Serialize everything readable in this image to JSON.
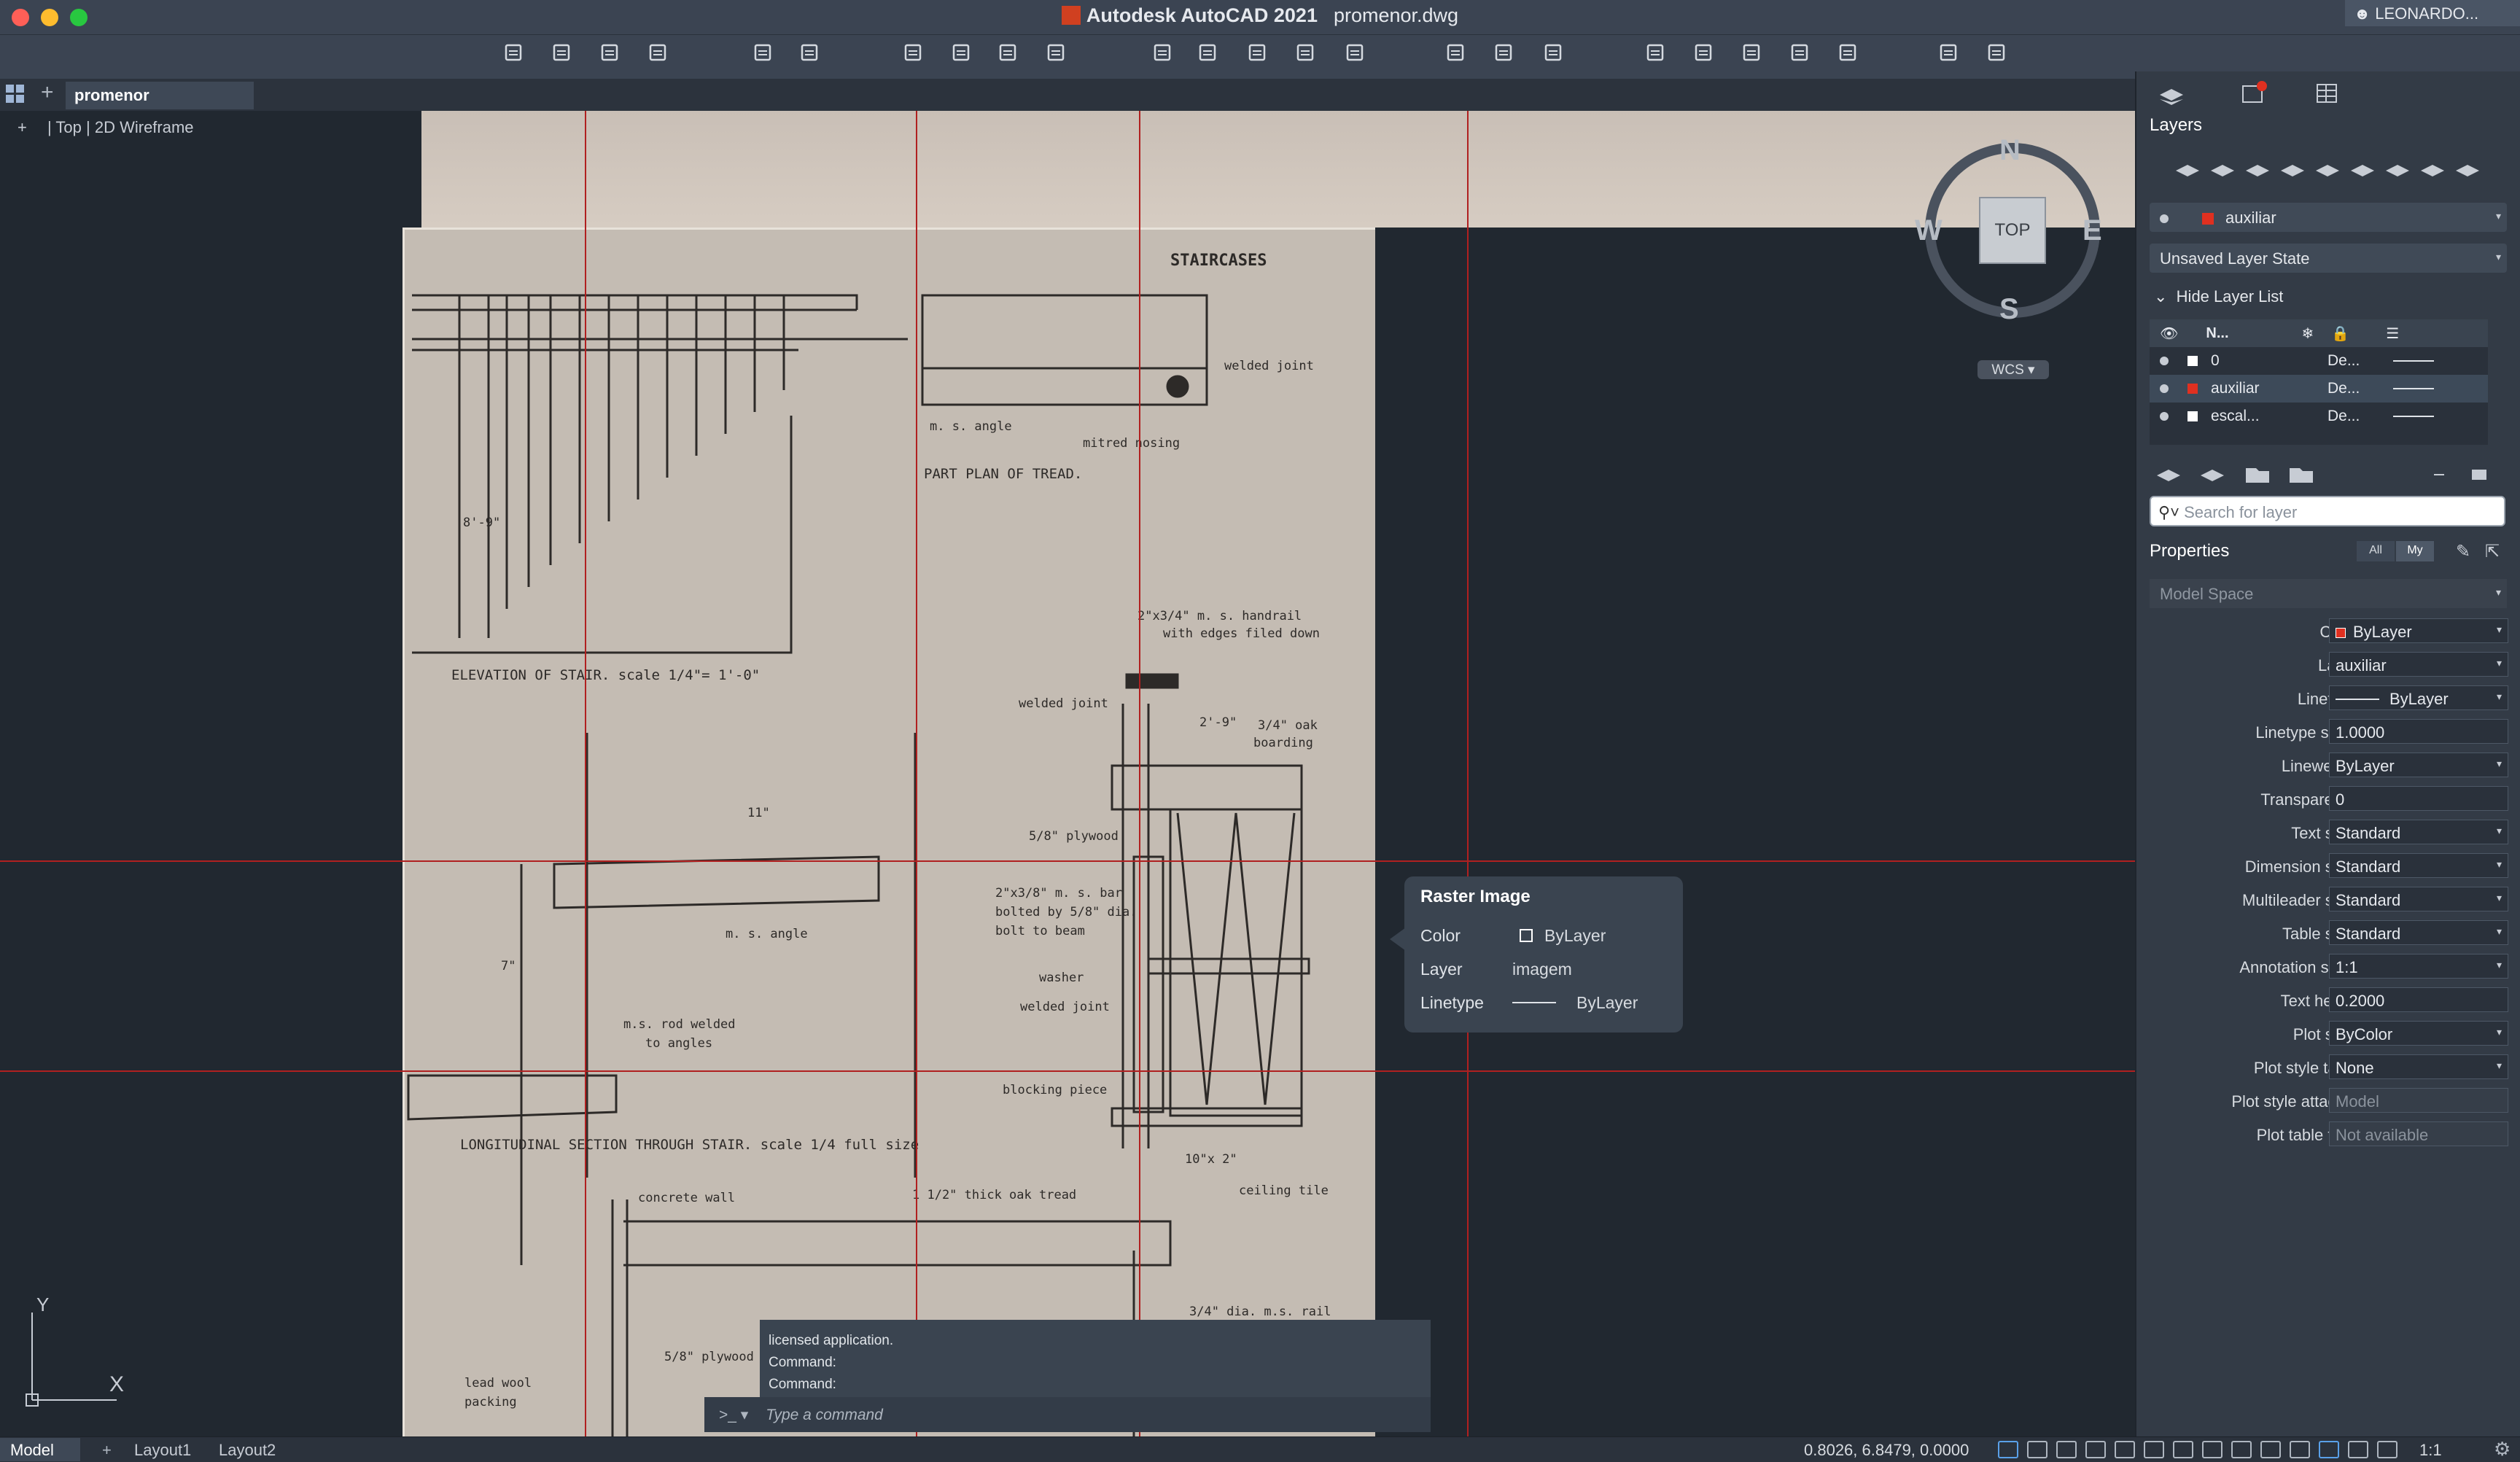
{
  "window": {
    "app_title": "Autodesk AutoCAD 2021",
    "doc_title": "promenor.dwg",
    "user": "LEONARDO..."
  },
  "tabs": {
    "file": "promenor"
  },
  "viewport": {
    "plus": "+",
    "view": "Top",
    "style": "2D Wireframe"
  },
  "viewcube": {
    "n": "N",
    "s": "S",
    "e": "E",
    "w": "W",
    "top": "TOP",
    "wcs": "WCS"
  },
  "drawing": {
    "staircases": "STAIRCASES",
    "welded_joint": "welded joint",
    "ms_angle": "m. s. angle",
    "mitred_nosing": "mitred nosing",
    "part_plan": "PART PLAN OF TREAD.",
    "dim_89": "8'-9\"",
    "elevation": "ELEVATION OF STAIR. scale 1/4\"= 1'-0\"",
    "handrail": "2\"x3/4\" m. s. handrail",
    "handrail2": "with edges filed down",
    "welded_joint2": "welded joint",
    "dim_29": "2'-9\"",
    "oak": "3/4\" oak",
    "boarding": "boarding",
    "dim_11": "11\"",
    "plywood": "5/8\" plywood",
    "ms_bar": "2\"x3/8\" m. s. bar",
    "bolted": "bolted by 5/8\" dia.",
    "bolt_beam": "bolt to beam",
    "ms_angle2": "m. s. angle",
    "washer": "washer",
    "welded_joint3": "welded joint",
    "dim_7": "7\"",
    "rod": "m.s. rod welded",
    "rod2": "to angles",
    "blocking": "blocking piece",
    "longitudinal": "LONGITUDINAL SECTION THROUGH STAIR. scale 1/4 full size",
    "dim_10": "10\"x 2\"",
    "ceiling": "ceiling tile",
    "concrete": "concrete wall",
    "oak_tread": "1 1/2\" thick oak tread",
    "plywood2": "5/8\" plywood",
    "lead_wool": "lead wool",
    "packing": "packing",
    "rail": "3/4\" dia. m.s. rail"
  },
  "tooltip": {
    "title": "Raster Image",
    "color_label": "Color",
    "color_value": "ByLayer",
    "layer_label": "Layer",
    "layer_value": "imagem",
    "linetype_label": "Linetype",
    "linetype_value": "ByLayer"
  },
  "command": {
    "history": [
      "licensed application.",
      "Command:",
      "Command:"
    ],
    "prompt": ">_",
    "placeholder": "Type a command"
  },
  "ucs": {
    "x": "X",
    "y": "Y"
  },
  "layers": {
    "title": "Layers",
    "current_layer": "auxiliar",
    "layer_state": "Unsaved Layer State",
    "hide_list": "Hide Layer List",
    "col_name": "N...",
    "rows": [
      {
        "name": "0",
        "desc": "De...",
        "color": "#ffffff"
      },
      {
        "name": "auxiliar",
        "desc": "De...",
        "color": "#e03020"
      },
      {
        "name": "escal...",
        "desc": "De...",
        "color": "#ffffff"
      }
    ],
    "search_placeholder": "Search for layer"
  },
  "properties": {
    "title": "Properties",
    "all": "All",
    "my": "My",
    "space": "Model Space",
    "rows": [
      {
        "label": "Color",
        "value": "ByLayer"
      },
      {
        "label": "Layer",
        "value": "auxiliar"
      },
      {
        "label": "Linetype",
        "value": "ByLayer"
      },
      {
        "label": "Linetype scale",
        "value": "1.0000"
      },
      {
        "label": "Lineweight",
        "value": "ByLayer"
      },
      {
        "label": "Transparency",
        "value": "0"
      },
      {
        "label": "Text style",
        "value": "Standard"
      },
      {
        "label": "Dimension style",
        "value": "Standard"
      },
      {
        "label": "Multileader style",
        "value": "Standard"
      },
      {
        "label": "Table style",
        "value": "Standard"
      },
      {
        "label": "Annotation scale",
        "value": "1:1"
      },
      {
        "label": "Text height",
        "value": "0.2000"
      },
      {
        "label": "Plot style",
        "value": "ByColor"
      },
      {
        "label": "Plot style table",
        "value": "None"
      },
      {
        "label": "Plot style attach...",
        "value": "Model"
      },
      {
        "label": "Plot table type",
        "value": "Not available"
      }
    ]
  },
  "status": {
    "model": "Model",
    "plus": "+",
    "layout1": "Layout1",
    "layout2": "Layout2",
    "coords": "0.8026, 6.8479, 0.0000",
    "scale": "1:1"
  },
  "colors": {
    "accent": "#e03020",
    "bg": "#212830",
    "panel": "#333b46"
  }
}
